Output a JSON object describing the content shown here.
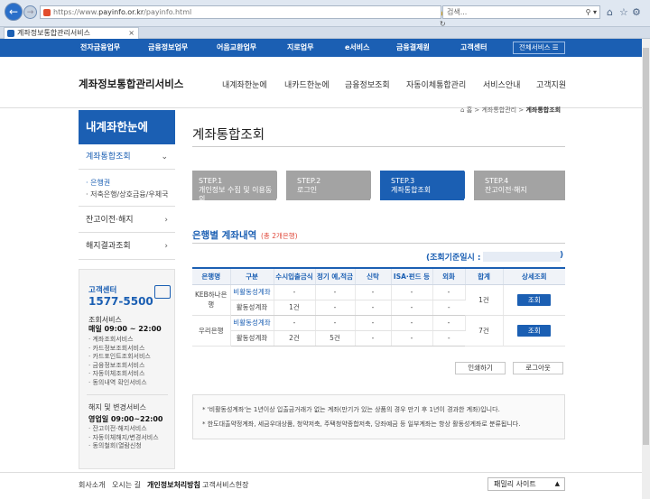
{
  "browser": {
    "url_prefix": "https://www.",
    "url_host": "payinfo.or.kr",
    "url_path": "/payinfo.html",
    "search_placeholder": "검색...",
    "tab_title": "계좌정보통합관리서비스"
  },
  "topnav": {
    "items": [
      "전자금융업무",
      "금융정보업무",
      "어음교환업무",
      "지로업무",
      "e서비스",
      "금융결제원",
      "고객센터"
    ],
    "all_services": "전체서비스"
  },
  "header": {
    "site_title": "계좌정보통합관리서비스",
    "menu": [
      "내계좌한눈에",
      "내카드한눈에",
      "금융정보조회",
      "자동이체통합관리",
      "서비스안내",
      "고객지원"
    ]
  },
  "sidebar": {
    "heading": "내계좌한눈에",
    "items": [
      {
        "label": "계좌통합조회",
        "chevron": "⌄"
      },
      {
        "label": "잔고이전·해지",
        "chevron": "›"
      },
      {
        "label": "해지결과조회",
        "chevron": "›"
      }
    ],
    "subitems": [
      "· 은행권",
      "· 저축은행/상호금융/우체국"
    ]
  },
  "customer_center": {
    "title": "고객센터",
    "phone": "1577-5500",
    "svc_label": "조회서비스",
    "svc_hours": "매일 09:00 ~ 22:00",
    "svc_list": [
      "· 계좌조회서비스",
      "· 카드정보조회서비스",
      "· 카드포인트조회서비스",
      "· 금융정보조회서비스",
      "· 자동이체조회서비스",
      "· 동의내역 확인서비스"
    ],
    "chg_label": "해지 및 변경서비스",
    "chg_hours": "영업일 09:00~22:00",
    "chg_list": [
      "· 잔고이전·해지서비스",
      "· 자동이체해지/변경서비스",
      "· 동의철회(열람신청"
    ]
  },
  "breadcrumb": {
    "home": "홈",
    "mid": "계좌통합관리",
    "current": "계좌통합조회"
  },
  "page_title": "계좌통합조회",
  "steps": [
    {
      "line1": "STEP.1",
      "line2": "개인정보 수집 및 이용동의"
    },
    {
      "line1": "STEP.2",
      "line2": "로그인"
    },
    {
      "line1": "STEP.3",
      "line2": "계좌통합조회"
    },
    {
      "line1": "STEP.4",
      "line2": "잔고이전·해지"
    }
  ],
  "section": {
    "title": "은행별 계좌내역",
    "sub": "(총 2개은행)"
  },
  "query_date": {
    "label": "(조회기준일시 :",
    "close": ")"
  },
  "table": {
    "headers": [
      "은행명",
      "구분",
      "수시입출금식",
      "정기 예,적금",
      "신탁",
      "ISA·펀드 등",
      "외화",
      "합계",
      "상세조회"
    ],
    "banks": [
      {
        "name": "KEB하나은행",
        "rows": [
          [
            "비활동성계좌",
            "-",
            "-",
            "-",
            "-",
            "-"
          ],
          [
            "활동성계좌",
            "1건",
            "-",
            "-",
            "-",
            "-"
          ]
        ],
        "total": "1건",
        "button": "조회"
      },
      {
        "name": "우리은행",
        "rows": [
          [
            "비활동성계좌",
            "-",
            "-",
            "-",
            "-",
            "-"
          ],
          [
            "활동성계좌",
            "2건",
            "5건",
            "-",
            "-",
            "-"
          ]
        ],
        "total": "7건",
        "button": "조회"
      }
    ]
  },
  "actions": {
    "print": "인쇄하기",
    "logout": "로그아웃"
  },
  "notes": [
    "* '비활동성계좌'는 1년이상 입출금거래가 없는 계좌(만기가 있는 상품의 경우 만기 후 1년이 경과한 계좌)입니다.",
    "* 한도대출약정계좌, 세금우대상품, 청약저축, 주택청약종합저축, 당좌예금 등 일부계좌는 항상 활동성계좌로 분류됩니다."
  ],
  "footer": {
    "links": [
      "회사소개",
      "오시는 길",
      "개인정보처리방침",
      "고객서비스헌장"
    ],
    "family_site": "패밀리 사이트"
  }
}
